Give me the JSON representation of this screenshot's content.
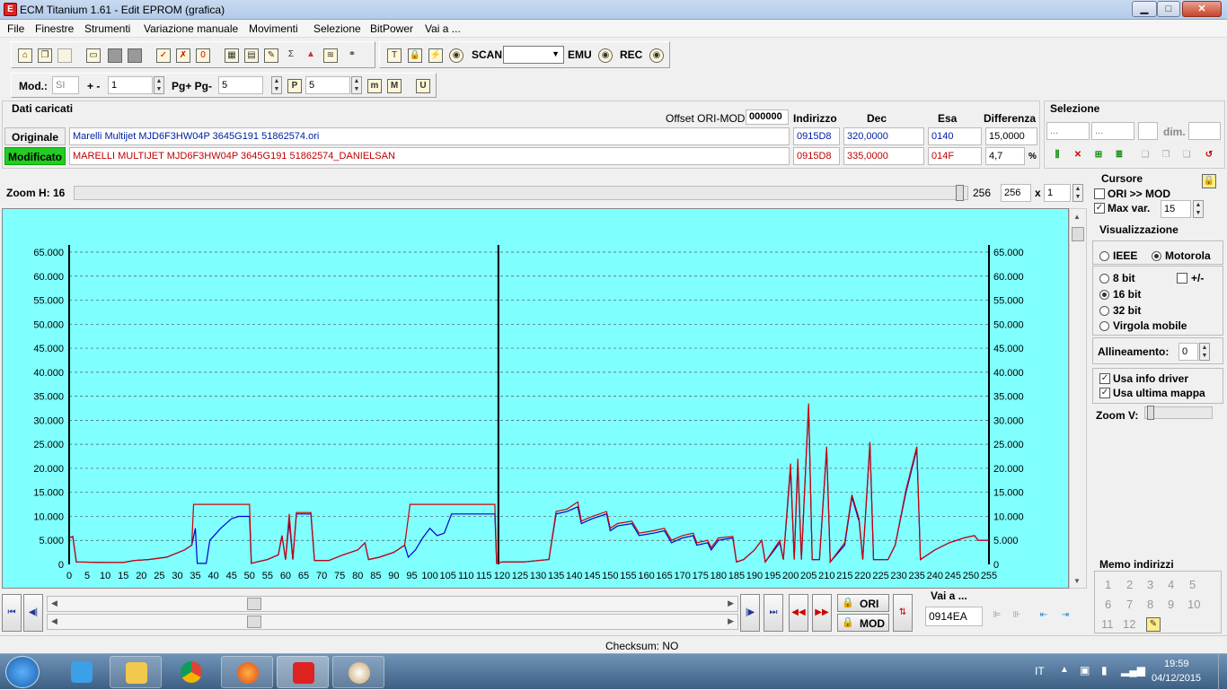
{
  "window": {
    "title": "ECM Titanium 1.61 - Edit EPROM (grafica)",
    "icon": "app-icon",
    "min": "▁",
    "max": "□",
    "close": "✕"
  },
  "menu": [
    "File",
    "Finestre",
    "Strumenti",
    "Variazione manuale",
    "Movimenti",
    "Selezione",
    "BitPower",
    "Vai a ..."
  ],
  "toolbar1": {
    "scan_label": "SCAN",
    "emu_label": "EMU",
    "rec_label": "REC"
  },
  "toolbar2": {
    "mod_label": "Mod.:",
    "mod_value": "SI",
    "plusminus_label": "+ -",
    "plusminus_value": "1",
    "pg_label": "Pg+ Pg-",
    "pg_value": "5",
    "p_icon": "P",
    "p_value": "5",
    "m_icon": "m",
    "M_icon": "M",
    "U_icon": "U"
  },
  "loaded": {
    "section_title": "Dati caricati",
    "offset_label": "Offset ORI-MOD",
    "offset_value": "000000",
    "col_indirizzo": "Indirizzo",
    "col_dec": "Dec",
    "col_esa": "Esa",
    "col_diff": "Differenza",
    "originale_label": "Originale",
    "originale_file": "Marelli Multijet MJD6F3HW04P 3645G191 51862574.ori",
    "originale_addr": "0915D8",
    "originale_dec": "320,0000",
    "originale_esa": "0140",
    "originale_diff": "15,0000",
    "modificato_label": "Modificato",
    "modificato_file": "MARELLI MULTIJET MJD6F3HW04P 3645G191 51862574_DANIELSAN",
    "modificato_addr": "0915D8",
    "modificato_dec": "335,0000",
    "modificato_esa": "014F",
    "modificato_diff": "4,7",
    "pct": "%"
  },
  "selezione": {
    "title": "Selezione",
    "f1": "...",
    "f2": "...",
    "dim_label": "dim.",
    "icons": [
      "select-start-icon",
      "select-clear-icon",
      "select-add-icon",
      "select-end-icon",
      "copy-icon",
      "paste-icon",
      "paste-special-icon",
      "undo-icon"
    ]
  },
  "zoom": {
    "label": "Zoom H: 16",
    "value_text": "256",
    "value_box": "256",
    "x_label": "x",
    "mult": "1"
  },
  "cursore": {
    "title": "Cursore",
    "ori_mod_label": "ORI >> MOD",
    "ori_mod_checked": false,
    "max_var_label": "Max var.",
    "max_var_checked": true,
    "max_var_value": "15"
  },
  "visualizzazione": {
    "title": "Visualizzazione",
    "ieee": "IEEE",
    "motorola": "Motorola",
    "bit8": "8 bit",
    "plusminus": "+/-",
    "bit16": "16 bit",
    "bit32": "32 bit",
    "virgola": "Virgola mobile",
    "allineamento_label": "Allineamento:",
    "allineamento_value": "0",
    "usa_info_driver": "Usa info driver",
    "usa_ultima_mappa": "Usa ultima mappa",
    "zoom_v_label": "Zoom V:"
  },
  "memo": {
    "title": "Memo indirizzi",
    "items": [
      "1",
      "2",
      "3",
      "4",
      "5",
      "6",
      "7",
      "8",
      "9",
      "10",
      "11",
      "12"
    ]
  },
  "bottom": {
    "ori_label": "ORI",
    "mod_label": "MOD",
    "vai_a_label": "Vai a ...",
    "vai_a_value": "0914EA",
    "checksum": "Checksum: NO"
  },
  "taskbar": {
    "lang": "IT",
    "time": "19:59",
    "date": "04/12/2015"
  },
  "colors": {
    "plot_bg": "#80ffff",
    "ori_line": "#0000cc",
    "mod_line": "#cc0000",
    "modificato_bg": "#22cc22"
  },
  "chart_data": {
    "type": "line",
    "ylim": [
      0,
      65000
    ],
    "xlim": [
      0,
      255
    ],
    "y_ticks": [
      "0",
      "5.000",
      "10.000",
      "15.000",
      "20.000",
      "25.000",
      "30.000",
      "35.000",
      "40.000",
      "45.000",
      "50.000",
      "55.000",
      "60.000",
      "65.000"
    ],
    "x_ticks": [
      "0",
      "5",
      "10",
      "15",
      "20",
      "25",
      "30",
      "35",
      "40",
      "45",
      "50",
      "55",
      "60",
      "65",
      "70",
      "75",
      "80",
      "85",
      "90",
      "95",
      "100",
      "105",
      "110",
      "115",
      "120",
      "125",
      "130",
      "135",
      "140",
      "145",
      "150",
      "155",
      "160",
      "165",
      "170",
      "175",
      "180",
      "185",
      "190",
      "195",
      "200",
      "205",
      "210",
      "215",
      "220",
      "225",
      "230",
      "235",
      "240",
      "245",
      "250",
      "255"
    ],
    "cursor_x": 119,
    "grid": true,
    "series": [
      {
        "color": "#0000cc",
        "points": [
          [
            0,
            5500
          ],
          [
            1,
            5800
          ],
          [
            2,
            500
          ],
          [
            10,
            400
          ],
          [
            15,
            400
          ],
          [
            18,
            800
          ],
          [
            22,
            1000
          ],
          [
            27,
            1500
          ],
          [
            32,
            3000
          ],
          [
            34,
            4000
          ],
          [
            35,
            7500
          ],
          [
            35.5,
            200
          ],
          [
            38,
            200
          ],
          [
            39,
            5000
          ],
          [
            42,
            7500
          ],
          [
            45,
            9500
          ],
          [
            47,
            10000
          ],
          [
            50,
            10000
          ],
          [
            50.5,
            200
          ],
          [
            52,
            500
          ],
          [
            55,
            1000
          ],
          [
            58,
            2000
          ],
          [
            59,
            6000
          ],
          [
            60,
            1000
          ],
          [
            61,
            9000
          ],
          [
            62,
            1000
          ],
          [
            63,
            10500
          ],
          [
            67,
            10500
          ],
          [
            68,
            800
          ],
          [
            72,
            800
          ],
          [
            76,
            2000
          ],
          [
            80,
            3000
          ],
          [
            82,
            4500
          ],
          [
            83,
            1000
          ],
          [
            86,
            1500
          ],
          [
            90,
            2500
          ],
          [
            93,
            4000
          ],
          [
            94,
            1500
          ],
          [
            96,
            3000
          ],
          [
            98,
            5500
          ],
          [
            100,
            7500
          ],
          [
            102,
            6000
          ],
          [
            104,
            6500
          ],
          [
            106,
            10500
          ],
          [
            115,
            10500
          ],
          [
            118,
            10500
          ],
          [
            118.5,
            200
          ],
          [
            120,
            500
          ],
          [
            126,
            500
          ],
          [
            130,
            800
          ],
          [
            133,
            1000
          ],
          [
            135,
            10500
          ],
          [
            138,
            11000
          ],
          [
            141,
            12000
          ],
          [
            142,
            8500
          ],
          [
            145,
            9500
          ],
          [
            149,
            10500
          ],
          [
            150,
            7000
          ],
          [
            152,
            8000
          ],
          [
            156,
            8500
          ],
          [
            158,
            6000
          ],
          [
            162,
            6500
          ],
          [
            165,
            7000
          ],
          [
            167,
            4500
          ],
          [
            170,
            5500
          ],
          [
            173,
            6000
          ],
          [
            174,
            4000
          ],
          [
            177,
            4500
          ],
          [
            178,
            3000
          ],
          [
            180,
            5000
          ],
          [
            184,
            5500
          ],
          [
            185,
            500
          ],
          [
            187,
            1000
          ],
          [
            190,
            3000
          ],
          [
            192,
            5000
          ],
          [
            193,
            500
          ],
          [
            197,
            4500
          ],
          [
            198,
            1000
          ],
          [
            200,
            20000
          ],
          [
            201,
            1000
          ],
          [
            202,
            21000
          ],
          [
            203,
            1000
          ],
          [
            205,
            33000
          ],
          [
            206,
            1000
          ],
          [
            208,
            1000
          ],
          [
            210,
            24000
          ],
          [
            211,
            500
          ],
          [
            215,
            4000
          ],
          [
            217,
            14000
          ],
          [
            219,
            9000
          ],
          [
            220,
            1000
          ],
          [
            222,
            25000
          ],
          [
            223,
            1000
          ],
          [
            227,
            1000
          ],
          [
            229,
            4000
          ],
          [
            232,
            15000
          ],
          [
            235,
            24000
          ],
          [
            236,
            1000
          ],
          [
            240,
            3000
          ],
          [
            244,
            4500
          ],
          [
            248,
            5500
          ],
          [
            251,
            6000
          ],
          [
            252,
            5000
          ],
          [
            255,
            5000
          ]
        ]
      },
      {
        "color": "#cc0000",
        "points": [
          [
            0,
            5500
          ],
          [
            1,
            5800
          ],
          [
            2,
            500
          ],
          [
            10,
            400
          ],
          [
            15,
            400
          ],
          [
            18,
            800
          ],
          [
            22,
            1000
          ],
          [
            27,
            1500
          ],
          [
            32,
            3000
          ],
          [
            34,
            4000
          ],
          [
            34.5,
            12500
          ],
          [
            50,
            12500
          ],
          [
            50.5,
            200
          ],
          [
            52,
            500
          ],
          [
            55,
            1000
          ],
          [
            58,
            2000
          ],
          [
            59,
            6000
          ],
          [
            60,
            1000
          ],
          [
            61,
            10500
          ],
          [
            62,
            1000
          ],
          [
            63,
            10800
          ],
          [
            67,
            10800
          ],
          [
            68,
            800
          ],
          [
            72,
            800
          ],
          [
            76,
            2000
          ],
          [
            80,
            3000
          ],
          [
            82,
            4500
          ],
          [
            83,
            1000
          ],
          [
            86,
            1500
          ],
          [
            90,
            2500
          ],
          [
            93,
            4000
          ],
          [
            94.5,
            12500
          ],
          [
            118,
            12500
          ],
          [
            118.5,
            200
          ],
          [
            120,
            500
          ],
          [
            126,
            500
          ],
          [
            130,
            800
          ],
          [
            133,
            1000
          ],
          [
            135,
            11000
          ],
          [
            138,
            11500
          ],
          [
            141,
            13000
          ],
          [
            142,
            9000
          ],
          [
            145,
            10000
          ],
          [
            149,
            11000
          ],
          [
            150,
            7500
          ],
          [
            152,
            8500
          ],
          [
            156,
            9000
          ],
          [
            158,
            6500
          ],
          [
            162,
            7000
          ],
          [
            165,
            7500
          ],
          [
            167,
            5000
          ],
          [
            170,
            6000
          ],
          [
            173,
            6500
          ],
          [
            174,
            4500
          ],
          [
            177,
            5000
          ],
          [
            178,
            3500
          ],
          [
            180,
            5500
          ],
          [
            184,
            5800
          ],
          [
            185,
            500
          ],
          [
            187,
            1000
          ],
          [
            190,
            3000
          ],
          [
            192,
            5000
          ],
          [
            193,
            500
          ],
          [
            197,
            5000
          ],
          [
            198,
            1000
          ],
          [
            200,
            21000
          ],
          [
            201,
            1000
          ],
          [
            202,
            22000
          ],
          [
            203,
            1000
          ],
          [
            205,
            33500
          ],
          [
            206,
            1000
          ],
          [
            208,
            1000
          ],
          [
            210,
            24500
          ],
          [
            211,
            500
          ],
          [
            215,
            4500
          ],
          [
            217,
            14500
          ],
          [
            219,
            9500
          ],
          [
            220,
            1000
          ],
          [
            222,
            25500
          ],
          [
            223,
            1000
          ],
          [
            227,
            1000
          ],
          [
            229,
            4000
          ],
          [
            232,
            15500
          ],
          [
            235,
            24500
          ],
          [
            236,
            1000
          ],
          [
            240,
            3000
          ],
          [
            244,
            4500
          ],
          [
            248,
            5500
          ],
          [
            251,
            6000
          ],
          [
            252,
            5000
          ],
          [
            255,
            5000
          ]
        ]
      }
    ]
  }
}
